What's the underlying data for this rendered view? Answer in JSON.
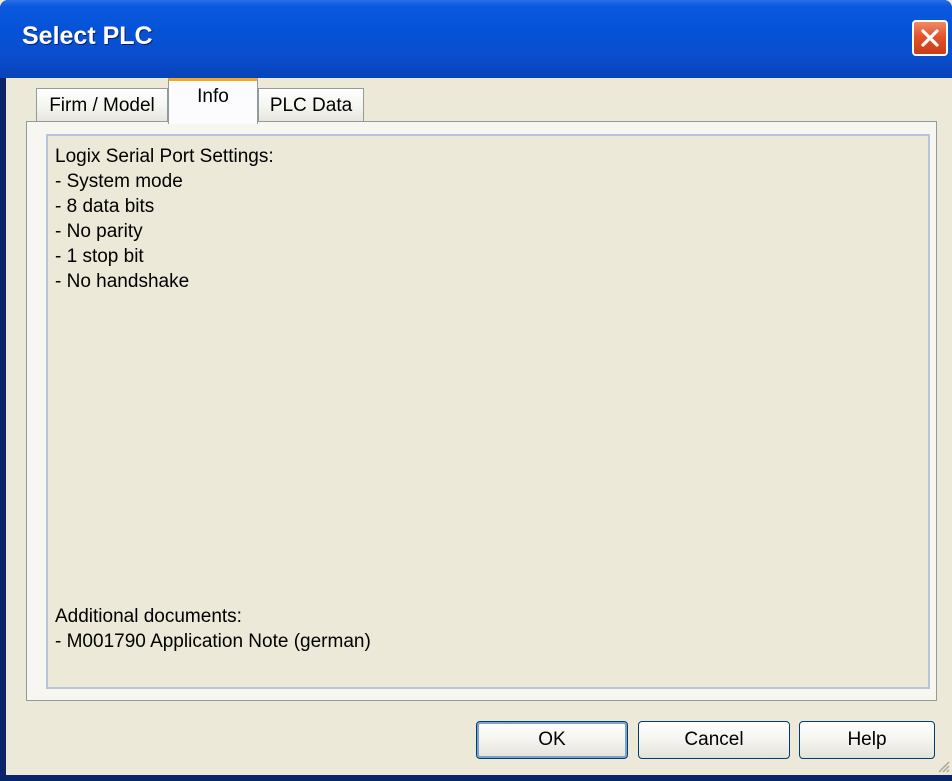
{
  "window": {
    "title": "Select PLC"
  },
  "tabs": [
    {
      "label": "Firm / Model",
      "active": false
    },
    {
      "label": "Info",
      "active": true
    },
    {
      "label": "PLC Data",
      "active": false
    }
  ],
  "info": {
    "settings_lines": [
      "Logix Serial Port Settings:",
      "- System mode",
      "- 8 data bits",
      "- No parity",
      "- 1 stop bit",
      "- No handshake"
    ],
    "docs_lines": [
      "Additional documents:",
      "- M001790 Application Note (german)"
    ]
  },
  "buttons": {
    "ok": "OK",
    "cancel": "Cancel",
    "help": "Help"
  },
  "icons": {
    "close": "close-icon",
    "resize": "resize-grip-icon"
  },
  "colors": {
    "titlebar": "#0552d6",
    "active_tab_accent": "#f5a623",
    "close_button": "#e2532c"
  }
}
